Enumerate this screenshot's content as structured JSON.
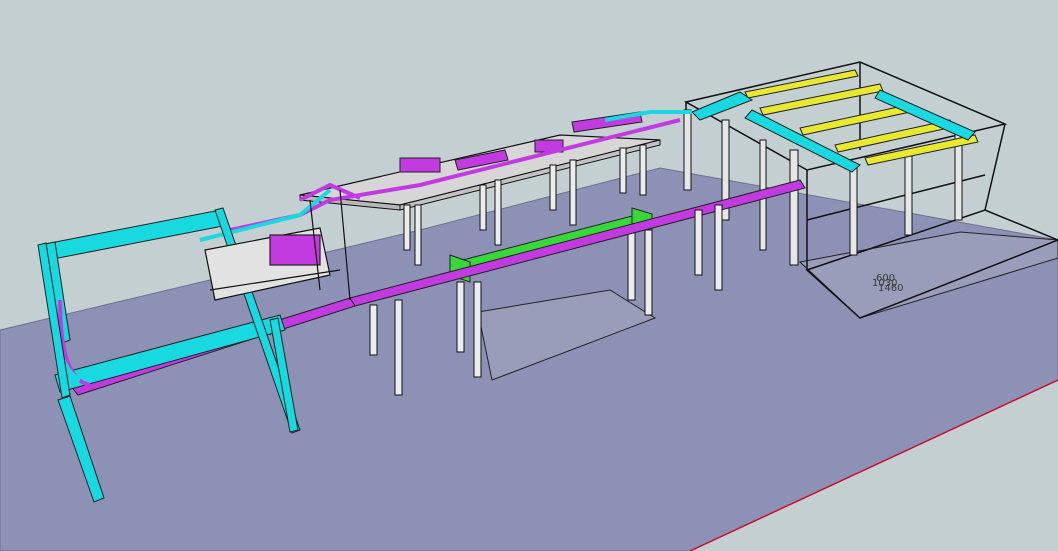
{
  "scene": {
    "colors": {
      "sky": "#c3cfd1",
      "floor": "#8d91b6",
      "steel": "#d9d9d9",
      "conveyor_cyan": "#18d8e0",
      "conveyor_magenta": "#c23be0",
      "conveyor_green": "#38d83a",
      "conveyor_yellow": "#e8e830",
      "edge": "#1a1a1a",
      "axis_red": "#c8102e"
    },
    "dimension_labels": [
      "600",
      "1030",
      "1460"
    ]
  }
}
